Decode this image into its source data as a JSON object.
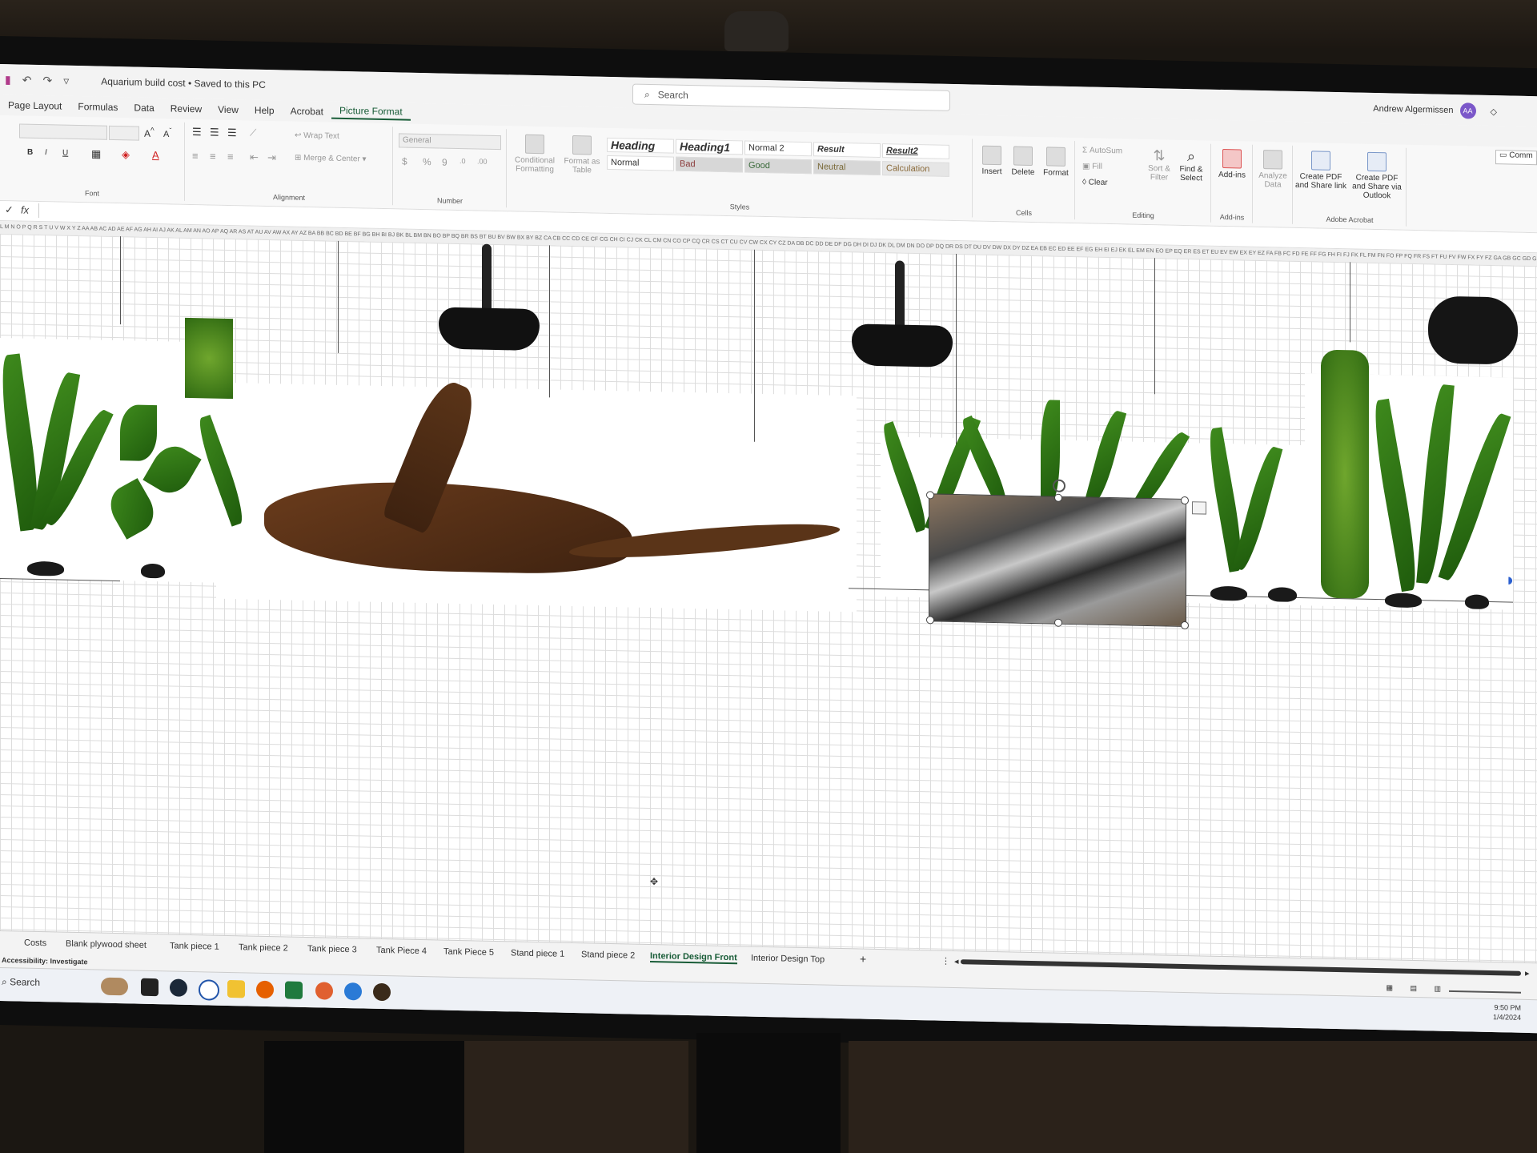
{
  "titlebar": {
    "document_title": "Aquarium build cost • Saved to this PC",
    "search_placeholder": "Search",
    "user_name": "Andrew Algermissen",
    "user_initials": "AA"
  },
  "menu": {
    "tabs": [
      "Page Layout",
      "Formulas",
      "Data",
      "Review",
      "View",
      "Help",
      "Acrobat",
      "Picture Format"
    ]
  },
  "ribbon": {
    "font_group": "Font",
    "alignment_group": "Alignment",
    "wrap_text": "Wrap Text",
    "merge_center": "Merge & Center",
    "number_format": "General",
    "number_group": "Number",
    "conditional_formatting": "Conditional Formatting",
    "format_as_table": "Format as Table",
    "styles_group": "Styles",
    "styles": {
      "heading": "Heading",
      "heading1": "Heading1",
      "normal2": "Normal 2",
      "result": "Result",
      "result2": "Result2",
      "normal": "Normal",
      "bad": "Bad",
      "good": "Good",
      "neutral": "Neutral",
      "calculation": "Calculation"
    },
    "insert": "Insert",
    "delete": "Delete",
    "format": "Format",
    "cells_group": "Cells",
    "autosum": "AutoSum",
    "fill": "Fill",
    "clear": "Clear",
    "sort_filter": "Sort & Filter",
    "find_select": "Find & Select",
    "editing_group": "Editing",
    "add_ins": "Add-ins",
    "add_ins_group": "Add-ins",
    "analyze_data": "Analyze Data",
    "create_pdf_share": "Create PDF and Share link",
    "create_pdf_outlook": "Create PDF and Share via Outlook",
    "adobe_group": "Adobe Acrobat",
    "comments": "Comm"
  },
  "formula_bar": {
    "fx": "fx"
  },
  "column_headers": "L M N O P Q R S T U V W X Y Z AA AB AC AD AE AF AG AH AI AJ AK AL AM AN AO AP AQ AR AS AT AU AV AW AX AY AZ BA BB BC BD BE BF BG BH BI BJ BK BL BM BN BO BP BQ BR BS BT BU BV BW BX BY BZ CA CB CC CD CE CF CG CH CI CJ CK CL CM CN CO CP CQ CR CS CT CU CV CW CX CY CZ DA DB DC DD DE DF DG DH DI DJ DK DL DM DN DO DP DQ DR DS DT DU DV DW DX DY DZ EA EB EC ED EE EF EG EH EI EJ EK EL EM EN EO EP EQ ER ES ET EU EV EW EX EY EZ FA FB FC FD FE FF FG FH FI FJ FK FL FM FN FO FP FQ FR FS FT FU FV FW FX FY FZ GA GB GC GD GE GF GG GH",
  "sheet_tabs": [
    "Costs",
    "Blank plywood sheet",
    "Tank piece 1",
    "Tank piece 2",
    "Tank piece 3",
    "Tank Piece 4",
    "Tank Piece 5",
    "Stand piece 1",
    "Stand piece 2",
    "Interior Design Front",
    "Interior Design Top"
  ],
  "active_sheet": "Interior Design Front",
  "status": {
    "accessibility": "Accessibility: Investigate"
  },
  "taskbar": {
    "search": "Search",
    "time": "9:50 PM",
    "date": "1/4/2024"
  }
}
